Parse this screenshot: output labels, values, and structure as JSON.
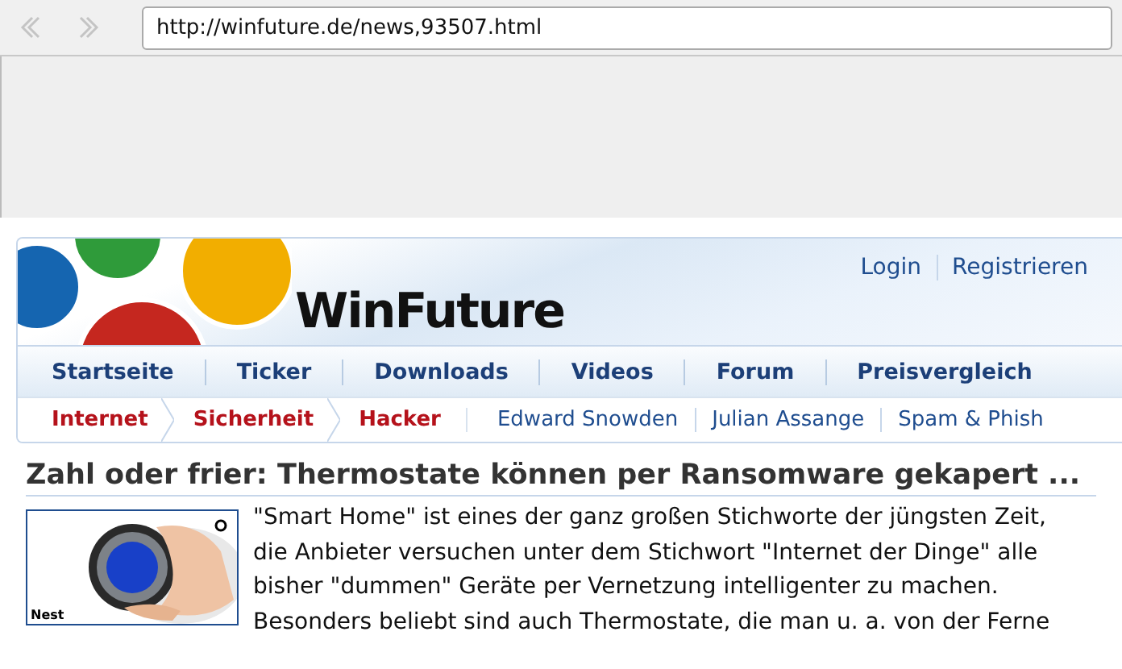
{
  "browser": {
    "url": "http://winfuture.de/news,93507.html"
  },
  "header": {
    "logo_text": "WinFuture",
    "account_links": [
      "Login",
      "Registrieren"
    ]
  },
  "nav": {
    "items": [
      {
        "label": "Startseite"
      },
      {
        "label": "Ticker"
      },
      {
        "label": "Downloads"
      },
      {
        "label": "Videos"
      },
      {
        "label": "Forum"
      },
      {
        "label": "Preisvergleich"
      }
    ]
  },
  "subnav": {
    "breadcrumbs": [
      "Internet",
      "Sicherheit",
      "Hacker"
    ],
    "tags": [
      "Edward Snowden",
      "Julian Assange",
      "Spam & Phish"
    ]
  },
  "article": {
    "title": "Zahl oder frier: Thermostate können per Ransomware gekapert ...",
    "image": {
      "kind": "picture",
      "credit": "Nest"
    },
    "lines": [
      "\"Smart Home\" ist eines der ganz großen Stichworte der jüngsten Zeit,",
      "die Anbieter versuchen unter dem Stichwort \"Internet der Dinge\" alle",
      "bisher \"dummen\" Geräte per Vernetzung intelligenter zu machen.",
      "Besonders beliebt sind auch Thermostate, die man u. a. von der Ferne"
    ]
  }
}
